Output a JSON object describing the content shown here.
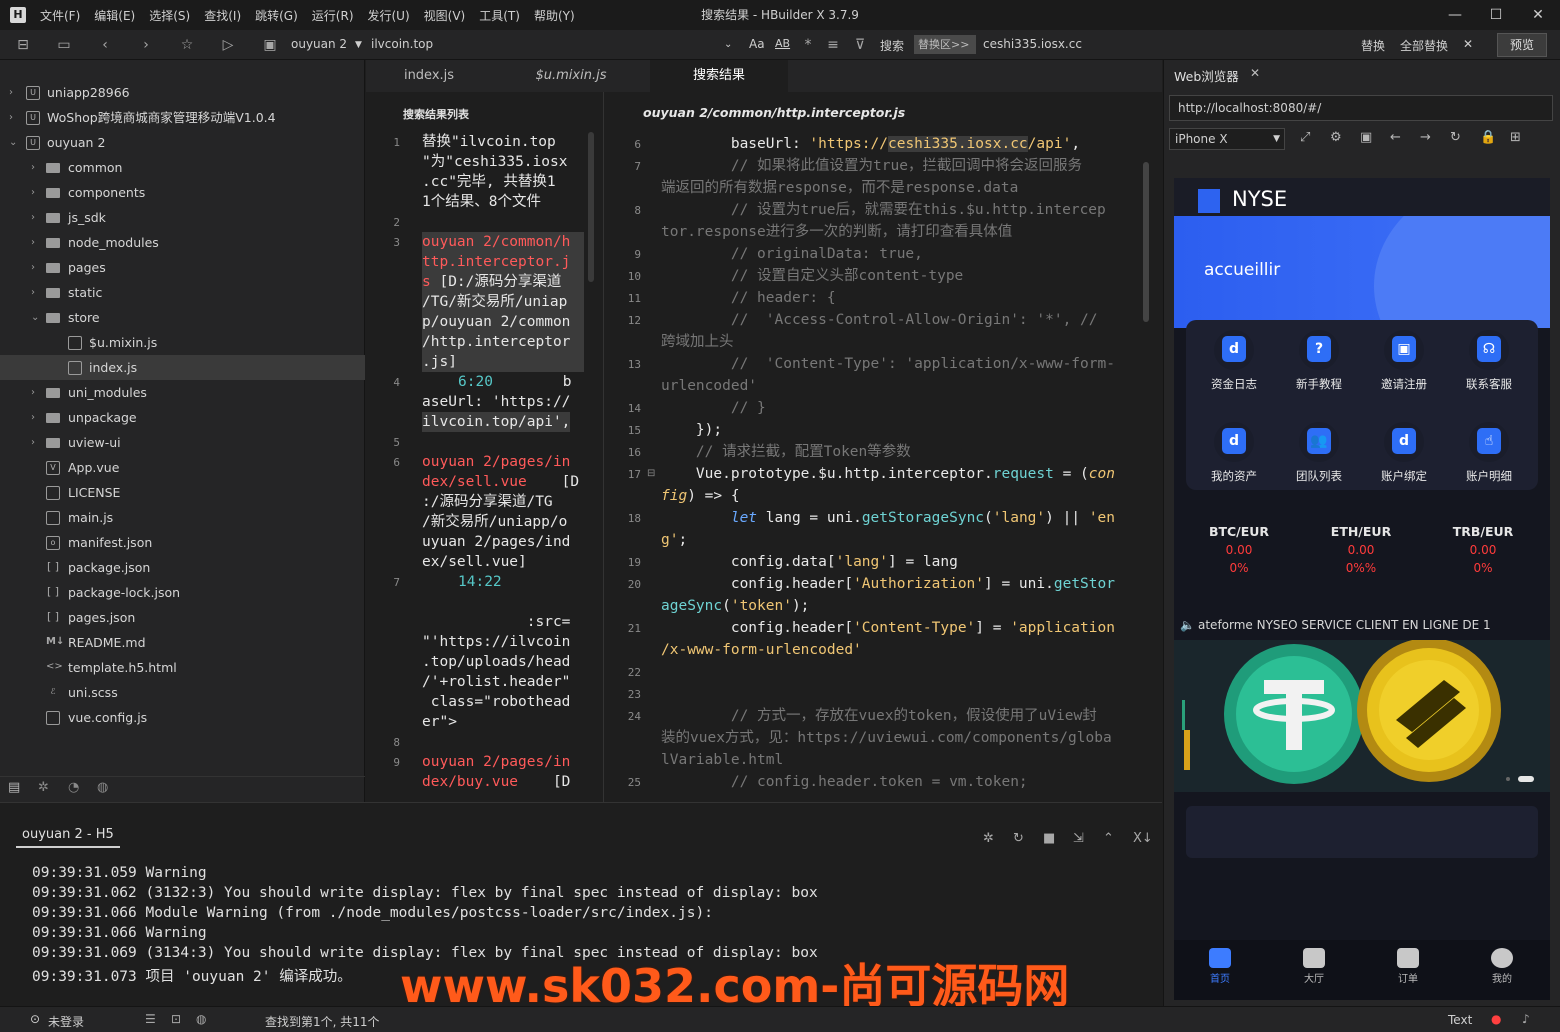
{
  "window": {
    "title": "搜索结果 - HBuilder X 3.7.9",
    "menu": [
      "文件(F)",
      "编辑(E)",
      "选择(S)",
      "查找(I)",
      "跳转(G)",
      "运行(R)",
      "发行(U)",
      "视图(V)",
      "工具(T)",
      "帮助(Y)"
    ]
  },
  "toolbar": {
    "project": "ouyuan 2",
    "file": "ilvcoin.top",
    "search_label": "搜索",
    "replace_placeholder": "替换区>>",
    "replace_value": "ceshi335.iosx.cc",
    "replace_label": "替换",
    "replace_all_label": "全部替换",
    "preview_label": "预览",
    "aa": "Aa",
    "ab": "AB"
  },
  "sidebar": {
    "items": [
      {
        "label": "uniapp28966"
      },
      {
        "label": "WoShop跨境商城商家管理移动端V1.0.4"
      },
      {
        "label": "ouyuan 2"
      },
      {
        "label": "common"
      },
      {
        "label": "components"
      },
      {
        "label": "js_sdk"
      },
      {
        "label": "node_modules"
      },
      {
        "label": "pages"
      },
      {
        "label": "static"
      },
      {
        "label": "store"
      },
      {
        "label": "$u.mixin.js"
      },
      {
        "label": "index.js"
      },
      {
        "label": "uni_modules"
      },
      {
        "label": "unpackage"
      },
      {
        "label": "uview-ui"
      },
      {
        "label": "App.vue"
      },
      {
        "label": "LICENSE"
      },
      {
        "label": "main.js"
      },
      {
        "label": "manifest.json"
      },
      {
        "label": "package.json"
      },
      {
        "label": "package-lock.json"
      },
      {
        "label": "pages.json"
      },
      {
        "label": "README.md"
      },
      {
        "label": "template.h5.html"
      },
      {
        "label": "uni.scss"
      },
      {
        "label": "vue.config.js"
      }
    ]
  },
  "tabs": [
    {
      "label": "index.js"
    },
    {
      "label": "$u.mixin.js"
    },
    {
      "label": "搜索结果"
    }
  ],
  "results": {
    "header": "搜索结果列表",
    "line_numbers": [
      "1",
      "2",
      "3",
      "4",
      "5",
      "6",
      "7",
      "8",
      "9"
    ],
    "summary": [
      "替换\"ilvcoin.top",
      "\"为\"ceshi335.iosx",
      ".cc\"完毕, 共替换1",
      "1个结果、8个文件"
    ],
    "file1": [
      "ouyuan 2/common/h",
      "ttp.interceptor.j",
      "s"
    ],
    "file1_path": [
      " [D:/源码分享渠道",
      "/TG/新交易所/uniap",
      "p/ouyuan 2/common",
      "/http.interceptor",
      ".js]"
    ],
    "hit1_pos": "6:20",
    "hit1_text": [
      "        b",
      "aseUrl: 'https://",
      "ilvcoin.top/api',"
    ],
    "file2": [
      "ouyuan 2/pages/in",
      "dex/sell.vue"
    ],
    "file2_path": [
      "    [D",
      ":/源码分享渠道/TG",
      "/新交易所/uniapp/o",
      "uyuan 2/pages/ind",
      "ex/sell.vue]"
    ],
    "hit2_pos": "14:22",
    "hit2_text": [
      "            :src=",
      "\"'https://ilvcoin",
      ".top/uploads/head",
      "/'+rolist.header\"",
      " class=\"robothead",
      "er\">"
    ],
    "file3": [
      "ouyuan 2/pages/in",
      "dex/buy.vue"
    ],
    "file3_path": "    [D"
  },
  "code": {
    "file_title": "ouyuan 2/common/http.interceptor.js",
    "line_numbers": [
      "6",
      "7",
      "8",
      "9",
      "10",
      "11",
      "12",
      "13",
      "14",
      "15",
      "16",
      "17",
      "18",
      "19",
      "20",
      "21",
      "22",
      "23",
      "24",
      "25"
    ],
    "l6_a": "        baseUrl: ",
    "l6_b": "'https://",
    "l6_c": "ceshi335.iosx.cc",
    "l6_d": "/api'",
    "l6_e": ",",
    "l7": "        // 如果将此值设置为true，拦截回调中将会返回服务",
    "l7b": "端返回的所有数据response，而不是response.data",
    "l8": "        // 设置为true后，就需要在this.$u.http.intercep",
    "l8b": "tor.response进行多一次的判断，请打印查看具体值",
    "l9": "        // originalData: true,",
    "l10": "        // 设置自定义头部content-type",
    "l11": "        // header: {",
    "l12": "        //  'Access-Control-Allow-Origin': '*', //",
    "l12b": "跨域加上头",
    "l13": "        //  'Content-Type': 'application/x-www-form-",
    "l13b": "urlencoded'",
    "l14": "        // }",
    "l15": "    });",
    "l16": "    // 请求拦截，配置Token等参数",
    "l17a": "    Vue.prototype.$u.http.interceptor.",
    "l17b": "request",
    "l17c": " = (",
    "l17d": "con",
    "l17e": "fig",
    "l17f": ") => {",
    "l18a": "        ",
    "l18b": "let",
    "l18c": " lang = uni.",
    "l18d": "getStorageSync",
    "l18e": "(",
    "l18f": "'lang'",
    "l18g": ") || ",
    "l18h": "'en",
    "l18i": "g'",
    "l18j": ";",
    "l19a": "        config.data[",
    "l19b": "'lang'",
    "l19c": "] = lang",
    "l20a": "        config.header[",
    "l20b": "'Authorization'",
    "l20c": "] = uni.",
    "l20d": "getStor",
    "l20e": "ageSync",
    "l20f": "(",
    "l20g": "'token'",
    "l20h": ");",
    "l21a": "        config.header[",
    "l21b": "'Content-Type'",
    "l21c": "] = ",
    "l21d": "'application",
    "l21e": "/x-www-form-urlencoded'",
    "l24": "        // 方式一，存放在vuex的token，假设使用了uView封",
    "l24b": "装的vuex方式，见：https://uviewui.com/components/globa",
    "l24c": "lVariable.html",
    "l25": "        // config.header.token = vm.token;"
  },
  "console": {
    "tab": "ouyuan 2 - H5",
    "lines": [
      "09:39:31.059 Warning",
      "09:39:31.062 (3132:3) You should write display: flex by final spec instead of display: box",
      "09:39:31.066 Module Warning (from ./node_modules/postcss-loader/src/index.js):",
      "09:39:31.066 Warning",
      "09:39:31.069 (3134:3) You should write display: flex by final spec instead of display: box",
      "09:39:31.073 项目 'ouyuan 2' 编译成功。"
    ],
    "watermark": "www.sk032.com-尚可源码网"
  },
  "status": {
    "login": "未登录",
    "search_info": "查找到第1个, 共11个",
    "mode": "Text"
  },
  "browser": {
    "tab": "Web浏览器",
    "url": "http://localhost:8080/#/",
    "device": "iPhone X",
    "app": {
      "logo": "NYSE",
      "welcome": "accueillir",
      "grid": [
        {
          "label": "资金日志",
          "glyph": "d"
        },
        {
          "label": "新手教程",
          "glyph": "?"
        },
        {
          "label": "邀请注册",
          "glyph": "▣"
        },
        {
          "label": "联系客服",
          "glyph": "☊"
        },
        {
          "label": "我的资产",
          "glyph": "d"
        },
        {
          "label": "团队列表",
          "glyph": "👥"
        },
        {
          "label": "账户绑定",
          "glyph": "d"
        },
        {
          "label": "账户明细",
          "glyph": "☝"
        }
      ],
      "markets": [
        {
          "pair": "BTC/EUR",
          "price": "0.00",
          "change": "0%"
        },
        {
          "pair": "ETH/EUR",
          "price": "0.00",
          "change": "0%%"
        },
        {
          "pair": "TRB/EUR",
          "price": "0.00",
          "change": "0%"
        }
      ],
      "notice": "ateforme NYSEO SERVICE CLIENT EN LIGNE DE 1",
      "nav": [
        {
          "label": "首页"
        },
        {
          "label": "大厅"
        },
        {
          "label": "订单"
        },
        {
          "label": "我的"
        }
      ]
    }
  },
  "colors": {
    "accent": "#2e6ef6",
    "error": "#ff5a5a",
    "watermark": "#ff5a1a",
    "market_red": "#ff3b3b"
  }
}
